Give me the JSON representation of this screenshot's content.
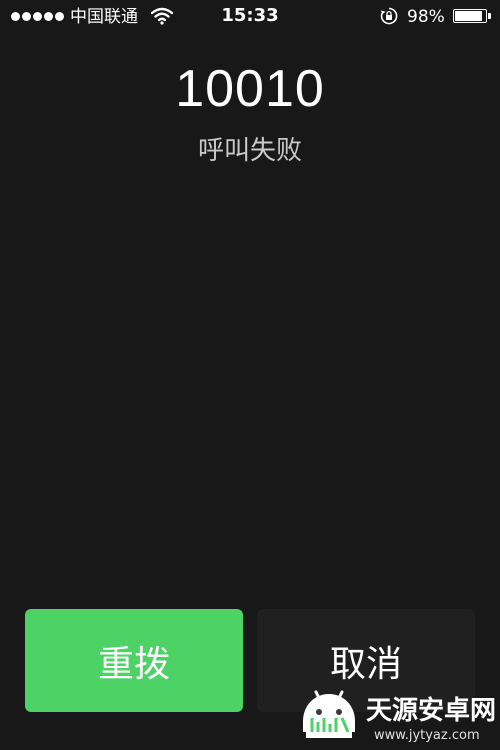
{
  "status_bar": {
    "signal_bars": 5,
    "carrier": "中国联通",
    "wifi_icon": "wifi-icon",
    "time": "15:33",
    "rotation_lock_icon": "rotation-lock-icon",
    "battery_percent": "98%",
    "battery_level": 0.98
  },
  "call": {
    "number": "10010",
    "status": "呼叫失败"
  },
  "actions": {
    "redial_label": "重拨",
    "cancel_label": "取消"
  },
  "watermark": {
    "name": "天源安卓网",
    "url": "www.jytyaz.com"
  },
  "colors": {
    "background": "#181818",
    "redial_button": "#4cd265",
    "cancel_button": "#202020",
    "status_text": "#c9c9c9"
  }
}
